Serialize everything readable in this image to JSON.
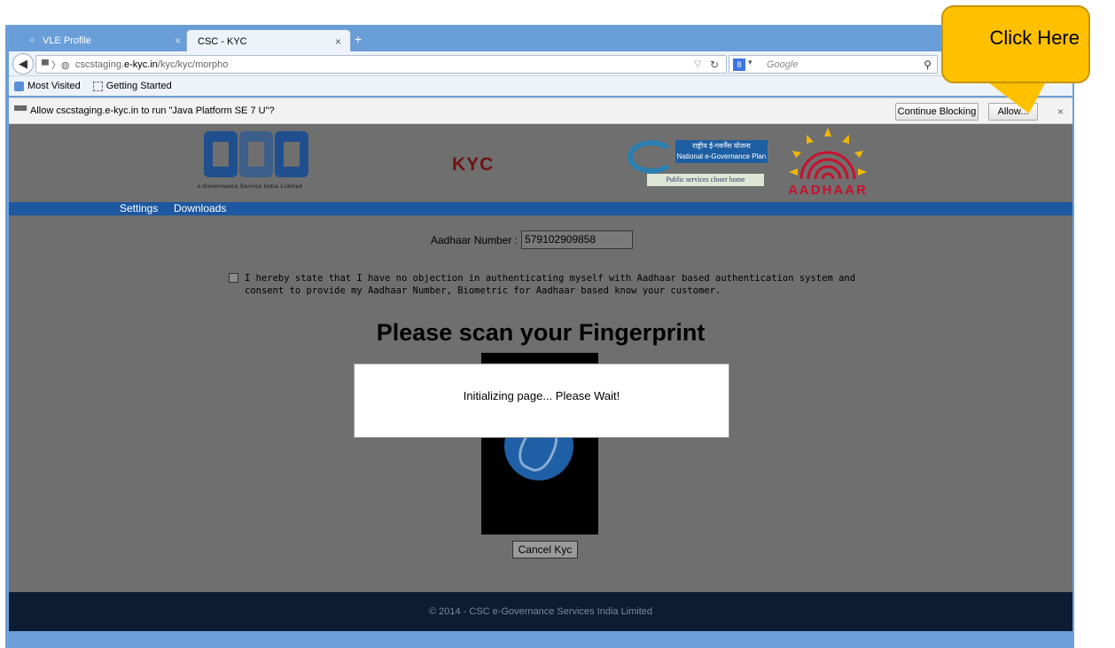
{
  "browser": {
    "tabs": [
      {
        "label": "VLE Profile",
        "close": "×",
        "icon": "profile-favicon"
      },
      {
        "label": "CSC - KYC",
        "close": "×"
      }
    ],
    "new_tab": "+",
    "url_host_prefix": "cscstaging.",
    "url_host_main": "e-kyc.in",
    "url_path": "/kyc/kyc/morpho",
    "search_placeholder": "Google",
    "search_engine": "8",
    "bookmarks": [
      "Most Visited",
      "Getting Started"
    ],
    "notification": {
      "message": "Allow cscstaging.e-kyc.in to run \"Java Platform SE 7 U\"?",
      "continue_blocking": "Continue Blocking",
      "allow": "Allow...",
      "close": "×"
    }
  },
  "page": {
    "logos": {
      "csc_tagline": "e-Governance Service India Limited",
      "kyc": "KYC",
      "negp_hindi": "राष्ट्रीय ई-गवर्नेंस योजना",
      "negp_english": "National e-Governance Plan",
      "negp_sub": "Public services closer home",
      "aadhaar": "AADHAAR"
    },
    "nav": {
      "settings": "Settings",
      "downloads": "Downloads"
    },
    "aadhaar_label": "Aadhaar Number :",
    "aadhaar_value": "579102909858",
    "consent_text": "I hereby state that I have no objection in authenticating myself with Aadhaar based authentication system and consent to provide my Aadhaar Number, Biometric for Aadhaar based know your customer.",
    "scan_title": "Please scan your Fingerprint",
    "cancel_label": "Cancel Kyc",
    "modal_text": "Initializing page... Please Wait!",
    "footer": "© 2014 - CSC e-Governance Services India Limited"
  },
  "callout": {
    "text": "Click Here",
    "color": "#ffc000"
  }
}
